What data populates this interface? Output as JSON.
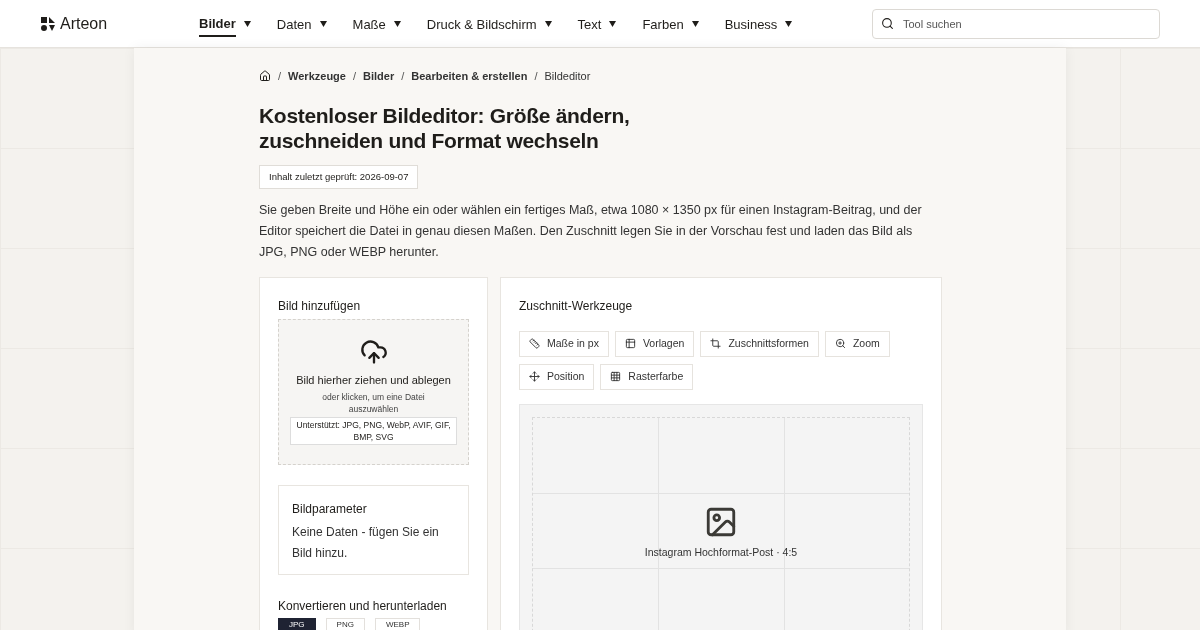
{
  "header": {
    "logo": "Arteon",
    "nav": [
      {
        "label": "Bilder",
        "selected": true
      },
      {
        "label": "Daten",
        "selected": false
      },
      {
        "label": "Maße",
        "selected": false
      },
      {
        "label": "Druck & Bildschirm",
        "selected": false
      },
      {
        "label": "Text",
        "selected": false
      },
      {
        "label": "Farben",
        "selected": false
      },
      {
        "label": "Business",
        "selected": false
      }
    ],
    "search": {
      "placeholder": "Tool suchen"
    }
  },
  "breadcrumb": {
    "separator": "/",
    "items": [
      "Werkzeuge",
      "Bilder",
      "Bearbeiten & erstellen",
      "Bildeditor"
    ]
  },
  "title": "Kostenloser Bildeditor: Größe ändern, zuschneiden und Format wechseln",
  "badge": "Inhalt zuletzt geprüft: 2026-09-07",
  "intro": "Sie geben Breite und Höhe ein oder wählen ein fertiges Maß, etwa 1080 × 1350 px für einen Instagram-Beitrag, und der Editor speichert die Datei in genau diesen Maßen. Den Zuschnitt legen Sie in der Vorschau fest und laden das Bild als JPG, PNG oder WEBP herunter.",
  "upload": {
    "heading": "Bild hinzufügen",
    "title": "Bild hierher ziehen und ablegen",
    "hint": "oder klicken, um eine Datei auszuwählen",
    "formats": "Unterstützt: JPG, PNG, WebP, AVIF, GIF, BMP, SVG"
  },
  "params": {
    "heading": "Bildparameter",
    "text": "Keine Daten - fügen Sie ein Bild hinzu."
  },
  "convert": {
    "heading": "Konvertieren und herunterladen",
    "formats": [
      {
        "label": "JPG",
        "selected": true
      },
      {
        "label": "PNG",
        "selected": false
      },
      {
        "label": "WEBP",
        "selected": false
      }
    ]
  },
  "tools": {
    "heading": "Zuschnitt-Werkzeuge",
    "buttons": [
      {
        "kind": "ruler",
        "label": "Maße in px"
      },
      {
        "kind": "table",
        "label": "Vorlagen"
      },
      {
        "kind": "crop",
        "label": "Zuschnittsformen"
      },
      {
        "kind": "zoom",
        "label": "Zoom"
      },
      {
        "kind": "move",
        "label": "Position"
      },
      {
        "kind": "grid",
        "label": "Rasterfarbe"
      }
    ]
  },
  "preview": {
    "caption": "Instagram Hochformat-Post · 4:5"
  }
}
